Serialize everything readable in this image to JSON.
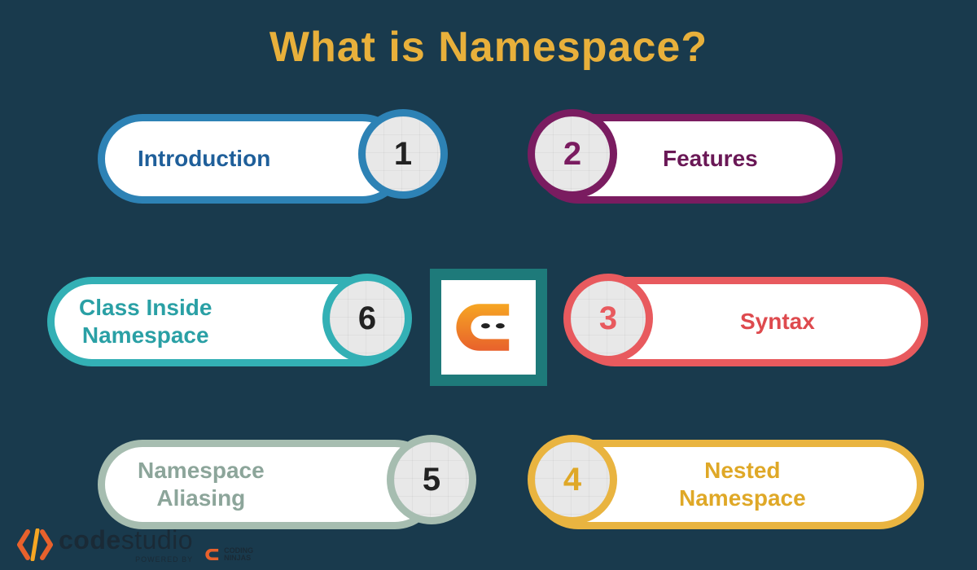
{
  "title": "What is Namespace?",
  "items": {
    "p1": {
      "num": "1",
      "label": "Introduction"
    },
    "p2": {
      "num": "2",
      "label": "Features"
    },
    "p3": {
      "num": "3",
      "label": "Syntax"
    },
    "p4": {
      "num": "4",
      "label": "Nested\nNamespace"
    },
    "p5": {
      "num": "5",
      "label": "Namespace\nAliasing"
    },
    "p6": {
      "num": "6",
      "label": "Class Inside\nNamespace"
    }
  },
  "footer": {
    "brand_code": "code",
    "brand_studio": "studio",
    "powered": "POWERED BY",
    "cn1": "CODING",
    "cn2": "NINJAS"
  },
  "colors": {
    "bg": "#193a4d",
    "title": "#e8b03b",
    "p1": "#2d82b5",
    "p2": "#7a1c60",
    "p3": "#e85a5e",
    "p4": "#e9b440",
    "p5": "#a6bdb0",
    "p6": "#33b0b5"
  }
}
